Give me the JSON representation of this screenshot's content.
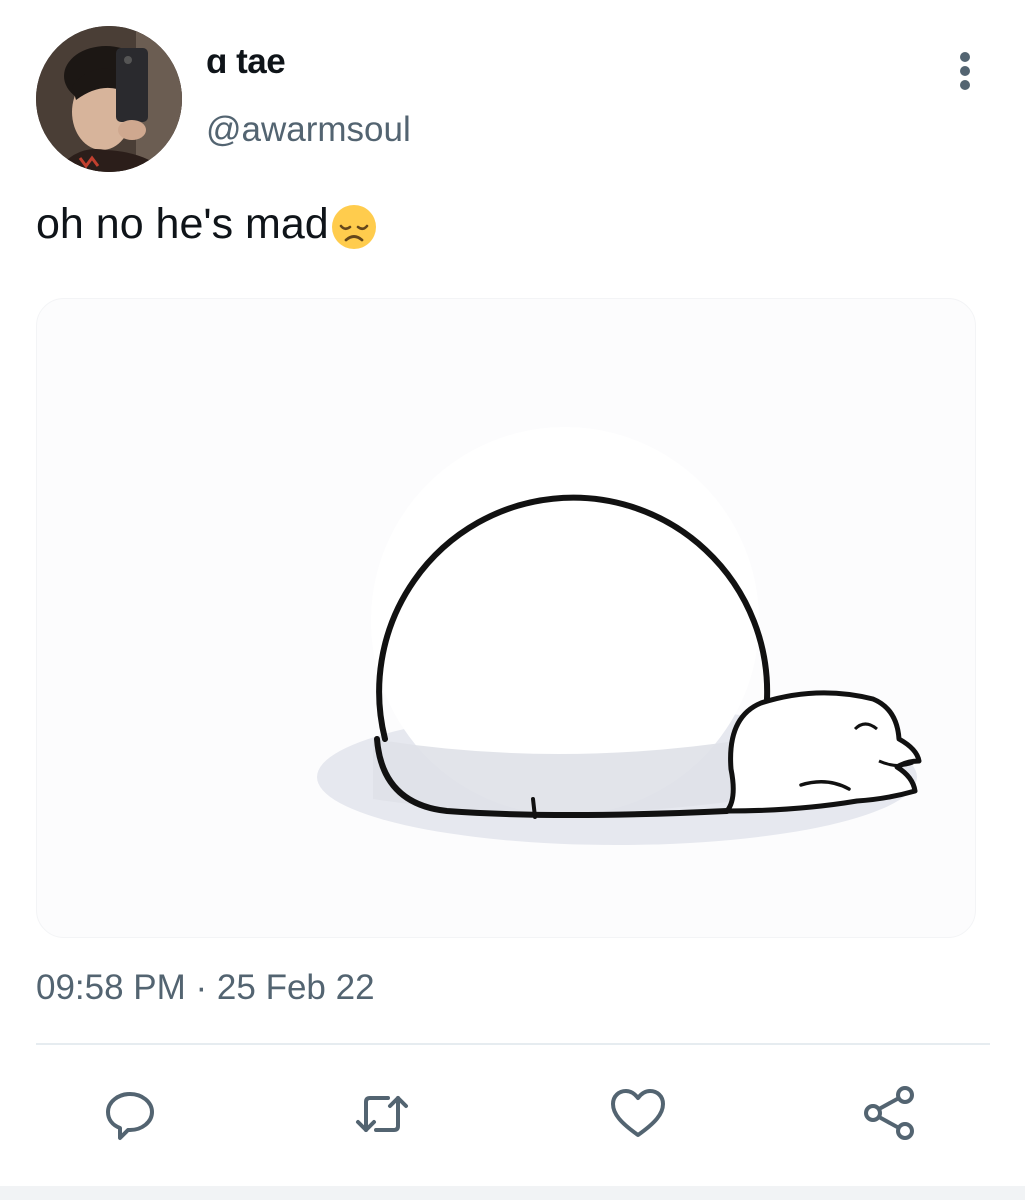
{
  "tweet": {
    "display_name": "ɑ tae",
    "handle": "@awarmsoul",
    "text": "oh no he's mad",
    "emoji": "disappointed-face-icon",
    "timestamp": "09:58 PM · 25 Feb 22"
  },
  "actions": [
    {
      "name": "reply",
      "icon": "reply-icon"
    },
    {
      "name": "retweet",
      "icon": "retweet-icon"
    },
    {
      "name": "like",
      "icon": "heart-icon"
    },
    {
      "name": "share",
      "icon": "share-icon"
    }
  ],
  "colors": {
    "text_primary": "#0f1419",
    "text_secondary": "#536471",
    "icon_gray": "#536471",
    "divider": "#e6ecf0"
  }
}
